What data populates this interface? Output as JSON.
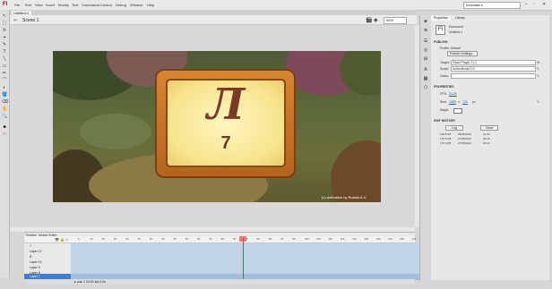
{
  "app": {
    "logo": "Fl"
  },
  "menu": [
    "File",
    "Edit",
    "View",
    "Insert",
    "Modify",
    "Text",
    "Commands",
    "Control",
    "Debug",
    "Window",
    "Help"
  ],
  "window": {
    "search_value": "Essentials ▾",
    "min": "–",
    "max": "▫",
    "close": "✕"
  },
  "tools": [
    "↖",
    "⬚",
    "⟳",
    "⌖",
    "✎",
    "T",
    "╲",
    "▭",
    "✏",
    "⌒",
    "◐",
    "🪣",
    "⌫",
    "✋",
    "🔍",
    "■",
    "□"
  ],
  "document": {
    "tab_label": "Untitled-1",
    "scene_label": "Scene 1",
    "zoom": "50%"
  },
  "stage": {
    "sign_letter": "Л",
    "sign_number": "7",
    "watermark": "(c) animation by Ruslan A.V."
  },
  "timeline": {
    "tabs": [
      "Timeline",
      "Motion Editor"
    ],
    "frame_numbers": [
      "5",
      "10",
      "15",
      "20",
      "25",
      "30",
      "35",
      "40",
      "45",
      "50",
      "55",
      "60",
      "65",
      "70",
      "75",
      "80",
      "85",
      "90",
      "95",
      "100",
      "105",
      "110",
      "115",
      "120",
      "125",
      "130",
      "135",
      "140",
      "145"
    ],
    "layers": [
      "7",
      "Layer 12",
      "Л",
      "Layer 10",
      "Layer 9",
      "Layer 8",
      "Layer 7"
    ],
    "footer": "▸ ◂ ▸▸ 1  24.00 fps  0.0s"
  },
  "side_icons": [
    "◈",
    "⊕",
    "☰",
    "◎",
    "⊞",
    "A",
    "▦",
    "⬡"
  ],
  "properties": {
    "tabs": [
      "Properties",
      "Library"
    ],
    "doc_label": "Document",
    "doc_name": "Untitled-1",
    "publish_header": "PUBLISH",
    "profile_label": "Profile: Default",
    "publish_settings_button": "Publish Settings...",
    "target_label": "Target:",
    "target_value": "Flash Player 11.2",
    "script_label": "Script:",
    "script_value": "ActionScript 3.0",
    "class_label": "Class:",
    "class_value": "",
    "props_header": "PROPERTIES",
    "fps_label": "FPS:",
    "fps_value": "24.00",
    "size_label": "Size:",
    "size_w": "1280",
    "size_x": "x",
    "size_h": "720",
    "size_unit": "px",
    "stage_label": "Stage:",
    "history_header": "SWF HISTORY",
    "log_button": "Log",
    "clear_button": "Clear",
    "history": [
      [
        "199.8 KB",
        "28/05/2012",
        "12:44"
      ],
      [
        "175.5 KB",
        "27/05/2012",
        "20:16"
      ],
      [
        "175.3 KB",
        "27/05/2012",
        "20:16"
      ]
    ]
  }
}
